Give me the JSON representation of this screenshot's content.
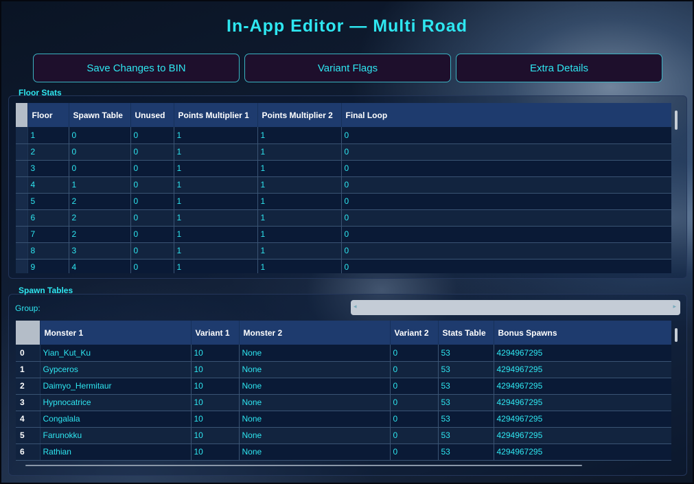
{
  "header": {
    "title": "In-App Editor — Multi Road"
  },
  "toolbar": {
    "save_label": "Save Changes to BIN",
    "variant_flags_label": "Variant Flags",
    "extra_details_label": "Extra Details"
  },
  "floor_stats": {
    "group_title": "Floor Stats",
    "columns": [
      "Floor",
      "Spawn Table",
      "Unused",
      "Points Multiplier 1",
      "Points Multiplier 2",
      "Final Loop"
    ],
    "rows": [
      [
        "1",
        "0",
        "0",
        "1",
        "1",
        "0"
      ],
      [
        "2",
        "0",
        "0",
        "1",
        "1",
        "0"
      ],
      [
        "3",
        "0",
        "0",
        "1",
        "1",
        "0"
      ],
      [
        "4",
        "1",
        "0",
        "1",
        "1",
        "0"
      ],
      [
        "5",
        "2",
        "0",
        "1",
        "1",
        "0"
      ],
      [
        "6",
        "2",
        "0",
        "1",
        "1",
        "0"
      ],
      [
        "7",
        "2",
        "0",
        "1",
        "1",
        "0"
      ],
      [
        "8",
        "3",
        "0",
        "1",
        "1",
        "0"
      ],
      [
        "9",
        "4",
        "0",
        "1",
        "1",
        "0"
      ]
    ]
  },
  "spawn_tables": {
    "group_title": "Spawn Tables",
    "group_label": "Group:",
    "group_value": "",
    "columns": [
      "Monster 1",
      "Variant 1",
      "Monster 2",
      "Variant 2",
      "Stats Table",
      "Bonus Spawns"
    ],
    "row_headers": [
      "0",
      "1",
      "2",
      "3",
      "4",
      "5",
      "6"
    ],
    "rows": [
      [
        "Yian_Kut_Ku",
        "10",
        "None",
        "0",
        "53",
        "4294967295"
      ],
      [
        "Gypceros",
        "10",
        "None",
        "0",
        "53",
        "4294967295"
      ],
      [
        "Daimyo_Hermitaur",
        "10",
        "None",
        "0",
        "53",
        "4294967295"
      ],
      [
        "Hypnocatrice",
        "10",
        "None",
        "0",
        "53",
        "4294967295"
      ],
      [
        "Congalala",
        "10",
        "None",
        "0",
        "53",
        "4294967295"
      ],
      [
        "Farunokku",
        "10",
        "None",
        "0",
        "53",
        "4294967295"
      ],
      [
        "Rathian",
        "10",
        "None",
        "0",
        "53",
        "4294967295"
      ]
    ]
  },
  "colors": {
    "accent": "#2ee6f0",
    "button_bg": "#1e0f2c",
    "header_bg": "#1e3b6e"
  }
}
